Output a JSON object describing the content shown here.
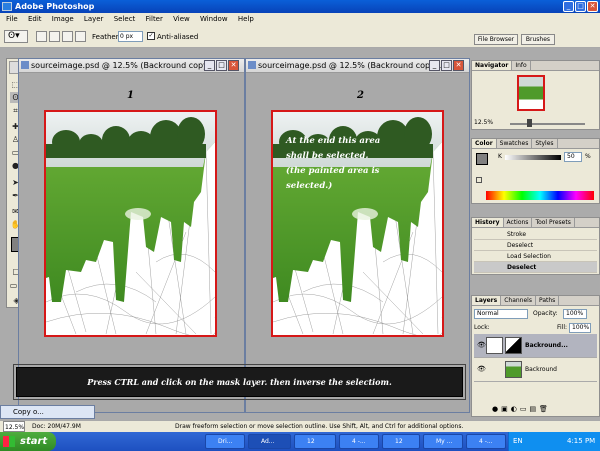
{
  "app": {
    "title": "Adobe Photoshop"
  },
  "menu": [
    "File",
    "Edit",
    "Image",
    "Layer",
    "Select",
    "Filter",
    "View",
    "Window",
    "Help"
  ],
  "options": {
    "feather_label": "Feather:",
    "feather_value": "0 px",
    "antialias_label": "Anti-aliased",
    "antialias_check": "✓",
    "file_browser": "File Browser",
    "brushes": "Brushes"
  },
  "doc1": {
    "title": "sourceimage.psd @ 12.5% (Backround copy...",
    "num": "1"
  },
  "doc2": {
    "title": "sourceimage.psd @ 12.5% (Backround copy...",
    "num": "2",
    "annotation": [
      "At the end this area",
      "shall be selected.",
      "(the painted area is",
      "selected.)"
    ]
  },
  "instruction": "Press CTRL and click on the mask layer. then inverse the selectiom.",
  "minidoc": "Copy o...",
  "status": {
    "zoom": "12.5%",
    "doc": "Doc: 20M/47.9M",
    "hint": "Draw freeform selection or move selection outline.  Use Shift, Alt, and Ctrl for additional options."
  },
  "navigator": {
    "tabs": [
      "Navigator",
      "Info"
    ],
    "zoom": "12.5%"
  },
  "color": {
    "tabs": [
      "Color",
      "Swatches",
      "Styles"
    ],
    "channel": "K",
    "value": "50",
    "unit": "%"
  },
  "history": {
    "tabs": [
      "History",
      "Actions",
      "Tool Presets"
    ],
    "items": [
      "Stroke",
      "Deselect",
      "Load Selection",
      "Deselect"
    ]
  },
  "layers": {
    "tabs": [
      "Layers",
      "Channels",
      "Paths"
    ],
    "mode": "Normal",
    "opacity_label": "Opacity:",
    "opacity": "100%",
    "lock_label": "Lock:",
    "fill_label": "Fill:",
    "fill": "100%",
    "items": [
      "Backround...",
      "Backround"
    ]
  },
  "taskbar": {
    "start": "start",
    "tasks": [
      "Dri...",
      "Ad...",
      "12",
      "4 -...",
      "12",
      "My ...",
      "4 -..."
    ],
    "lang": "EN",
    "time": "4:15 PM"
  },
  "colors": {
    "accent": "#0a5fd8",
    "canvas_border": "#d61818",
    "grass": "#4f9a2a"
  }
}
